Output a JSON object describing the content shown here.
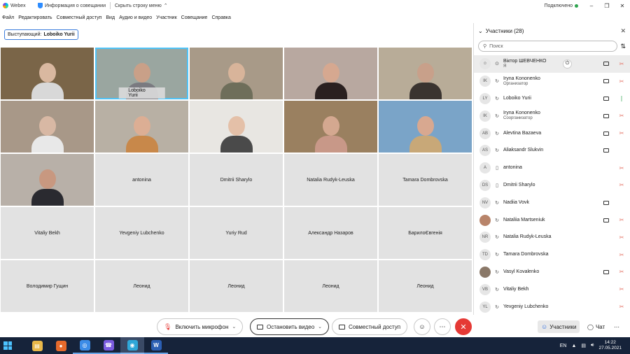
{
  "titlebar": {
    "app_name": "Webex",
    "meeting_info": "Информация о совещании",
    "hide_menu": "Скрыть строку меню",
    "connection": "Подключено"
  },
  "menu": [
    "Файл",
    "Редактировать",
    "Совместный доступ",
    "Вид",
    "Аудио и видео",
    "Участник",
    "Совещание",
    "Справка"
  ],
  "speaker": {
    "label": "Выступающий:",
    "name": "Loboiko Yurii"
  },
  "grid": [
    {
      "name": "",
      "video": true,
      "skin": "#d9b8a0",
      "cloth": "#d8d8d8",
      "bg": "#7a6548"
    },
    {
      "name": "Loboiko Yurii",
      "video": true,
      "active": true,
      "skin": "#c9a088",
      "cloth": "#7a7a80",
      "bg": "#9aa6a0"
    },
    {
      "name": "",
      "video": true,
      "skin": "#d8b49a",
      "cloth": "#6e6e5a",
      "bg": "#a89a88"
    },
    {
      "name": "",
      "video": true,
      "skin": "#d6a890",
      "cloth": "#2a2020",
      "bg": "#b8a8a0"
    },
    {
      "name": "",
      "video": true,
      "skin": "#c8a08a",
      "cloth": "#3a3430",
      "bg": "#b8ac98"
    },
    {
      "name": "",
      "video": true,
      "skin": "#d8b8a4",
      "cloth": "#e8e8e8",
      "bg": "#a89888"
    },
    {
      "name": "",
      "video": true,
      "skin": "#dcae94",
      "cloth": "#c8884a",
      "bg": "#b8b0a4"
    },
    {
      "name": "",
      "video": true,
      "skin": "#e4c0a8",
      "cloth": "#4a4a4a",
      "bg": "#e8e6e2"
    },
    {
      "name": "",
      "video": true,
      "skin": "#d4a890",
      "cloth": "#c89888",
      "bg": "#9a8060"
    },
    {
      "name": "",
      "video": true,
      "skin": "#d8a890",
      "cloth": "#c8a878",
      "bg": "#7aa4c8"
    },
    {
      "name": "",
      "video": true,
      "skin": "#c89880",
      "cloth": "#2a2a30",
      "bg": "#b8b0a8"
    },
    {
      "name": "antonina",
      "video": false
    },
    {
      "name": "Dmitrii Sharylo",
      "video": false
    },
    {
      "name": "Natalia Rudyk-Leuska",
      "video": false
    },
    {
      "name": "Tamara Dombrovska",
      "video": false
    },
    {
      "name": "Vitaliy Bekh",
      "video": false
    },
    {
      "name": "Yevgeniy Lubchenko",
      "video": false
    },
    {
      "name": "Yuriy Rud",
      "video": false
    },
    {
      "name": "Александр Назаров",
      "video": false
    },
    {
      "name": "БарилоЄвгенія",
      "video": false
    },
    {
      "name": "Володимир Гущин",
      "video": false
    },
    {
      "name": "Леонид",
      "video": false
    },
    {
      "name": "Леонид",
      "video": false
    },
    {
      "name": "Леонид",
      "video": false
    },
    {
      "name": "Леонид",
      "video": false
    }
  ],
  "controls": {
    "unmute": "Включить микрофон",
    "stop_video": "Остановить видео",
    "share": "Совместный доступ",
    "participants": "Участники",
    "chat": "Чат"
  },
  "panel": {
    "title": "Участники (28)",
    "search_placeholder": "Поиск",
    "participants": [
      {
        "initials": "",
        "avatar": "generic",
        "device": "⊙",
        "name": "Віктор ШЕВЧЕНКО",
        "role": "Я",
        "cam": true,
        "mic": "muted",
        "selected": true
      },
      {
        "initials": "IK",
        "avatar": "initials",
        "device": "↻",
        "name": "Iryna Kononenko",
        "role": "Организатор",
        "cam": true,
        "mic": "muted"
      },
      {
        "initials": "LY",
        "avatar": "initials",
        "device": "↻",
        "name": "Loboiko Yurii",
        "role": "",
        "cam": true,
        "mic": "on"
      },
      {
        "initials": "IK",
        "avatar": "initials",
        "device": "↻",
        "name": "Iryna Kononenko",
        "role": "Соорганизатор",
        "cam": true,
        "mic": "muted"
      },
      {
        "initials": "AB",
        "avatar": "initials",
        "device": "↻",
        "name": "Alevtina Bazaeva",
        "role": "",
        "cam": true,
        "mic": "muted"
      },
      {
        "initials": "AS",
        "avatar": "initials",
        "device": "↻",
        "name": "Aliaksandr Slukvin",
        "role": "",
        "cam": true,
        "mic": "none"
      },
      {
        "initials": "A",
        "avatar": "initials",
        "device": "▯",
        "name": "antonina",
        "role": "",
        "cam": false,
        "mic": "muted"
      },
      {
        "initials": "DS",
        "avatar": "initials",
        "device": "▯",
        "name": "Dmitrii Sharylo",
        "role": "",
        "cam": false,
        "mic": "muted"
      },
      {
        "initials": "NV",
        "avatar": "initials",
        "device": "↻",
        "name": "Nadiia Vovk",
        "role": "",
        "cam": true,
        "mic": "none"
      },
      {
        "initials": "",
        "avatar": "photo",
        "device": "↻",
        "name": "Nataliia Martseniuk",
        "role": "",
        "cam": true,
        "mic": "muted"
      },
      {
        "initials": "NR",
        "avatar": "initials",
        "device": "↻",
        "name": "Natalia Rudyk-Leuska",
        "role": "",
        "cam": false,
        "mic": "muted"
      },
      {
        "initials": "TD",
        "avatar": "initials",
        "device": "↻",
        "name": "Tamara Dombrovska",
        "role": "",
        "cam": false,
        "mic": "muted"
      },
      {
        "initials": "",
        "avatar": "photo2",
        "device": "↻",
        "name": "Vasyl Kovalenko",
        "role": "",
        "cam": true,
        "mic": "muted"
      },
      {
        "initials": "VB",
        "avatar": "initials",
        "device": "↻",
        "name": "Vitaliy Bekh",
        "role": "",
        "cam": false,
        "mic": "muted"
      },
      {
        "initials": "YL",
        "avatar": "initials",
        "device": "↻",
        "name": "Yevgeniy Lubchenko",
        "role": "",
        "cam": false,
        "mic": "muted"
      }
    ]
  },
  "taskbar": {
    "apps": [
      {
        "name": "file-explorer-icon",
        "color": "#e8b84a",
        "glyph": "▤"
      },
      {
        "name": "firefox-icon",
        "color": "#e66a2c",
        "glyph": "●"
      },
      {
        "name": "chrome-icon",
        "color": "#3c8ce7",
        "glyph": "◎"
      },
      {
        "name": "viber-icon",
        "color": "#7a5ce0",
        "glyph": "☎"
      },
      {
        "name": "webex-icon",
        "color": "#2fa7d8",
        "glyph": "◉"
      },
      {
        "name": "word-icon",
        "color": "#2b5fb4",
        "glyph": "W"
      }
    ],
    "lang": "EN",
    "time": "14:22",
    "date": "27.05.2021"
  },
  "colors": {
    "accent": "#2d6cdf",
    "end_call": "#e53935",
    "muted_mic": "#e57366",
    "active_mic": "#2ea44f",
    "active_tile": "#4fc3f7"
  }
}
